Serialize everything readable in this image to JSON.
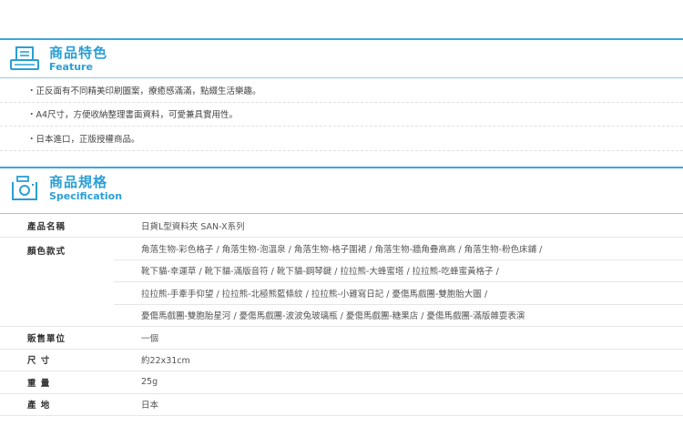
{
  "feature": {
    "title": "商品特色",
    "subtitle": "Feature",
    "items": [
      "・正反面有不同精美印刷圖案，療癒感滿滿，點綴生活樂趣。",
      "・A4尺寸，方便收納整理書面資料，可愛兼具實用性。",
      "・日本進口，正版授權商品。"
    ]
  },
  "spec": {
    "title": "商品規格",
    "subtitle": "Specification",
    "rows": {
      "name": {
        "label": "產品名稱",
        "value": "日貨L型資料夾 SAN-X系列"
      },
      "colors": {
        "label": "顏色款式",
        "lines": [
          "角落生物-彩色格子 / 角落生物-泡溫泉 / 角落生物-格子圍裙 / 角落生物-牆角疊高高 / 角落生物-粉色床鋪 /",
          "靴下貓-幸運草 / 靴下貓-滿版音符 / 靴下貓-鋼琴鍵 / 拉拉熊-大蜂蜜塔 / 拉拉熊-吃蜂蜜黃格子 /",
          "拉拉熊-手牽手仰望 / 拉拉熊-北極熊藍條紋 / 拉拉熊-小雞寫日記 / 憂傷馬戲團-雙胞胎大圖 /",
          "憂傷馬戲團-雙胞胎星河 / 憂傷馬戲團-波波兔玻璃瓶 / 憂傷馬戲團-糖果店 / 憂傷馬戲團-滿版雜耍表演"
        ]
      },
      "unit": {
        "label": "販售單位",
        "value": "一個"
      },
      "size": {
        "label": "尺 寸",
        "value": "約22x31cm"
      },
      "weight": {
        "label": "重 量",
        "value": "25g"
      },
      "origin": {
        "label": "產 地",
        "value": "日本"
      }
    }
  },
  "colors": {
    "accent": "#2a9fd6",
    "rule": "#3aa7d9"
  }
}
